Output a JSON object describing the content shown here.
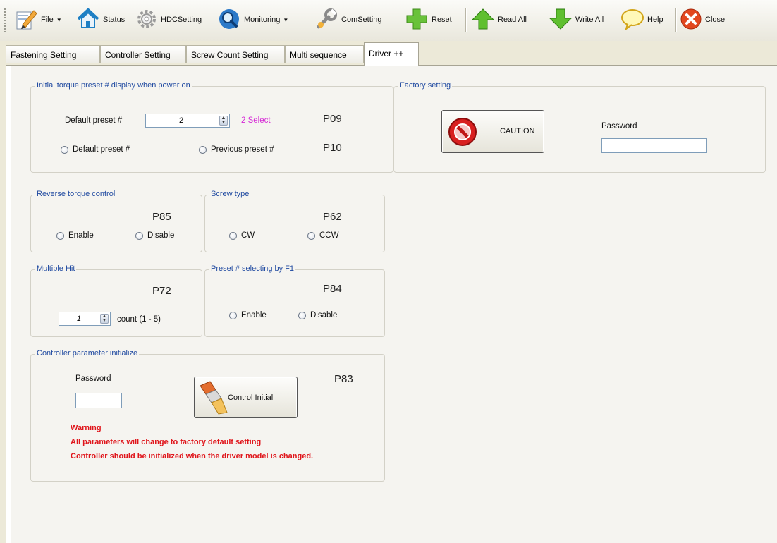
{
  "toolbar": {
    "file": "File",
    "status": "Status",
    "hdc_setting": "HDCSetting",
    "monitoring": "Monitoring",
    "com_setting": "ComSetting",
    "reset": "Reset",
    "read_all": "Read All",
    "write_all": "Write All",
    "help": "Help",
    "close": "Close"
  },
  "tabs": [
    "Fastening Setting",
    "Controller Setting",
    "Screw Count Setting",
    "Multi sequence",
    "Driver ++"
  ],
  "active_tab": "Driver ++",
  "initial_torque": {
    "title": "Initial torque preset # display when power on",
    "default_preset_label": "Default preset #",
    "default_preset_value": "2",
    "select_text": "2 Select",
    "p09": "P09",
    "p10": "P10",
    "radio_default": "Default preset #",
    "radio_previous": "Previous preset #"
  },
  "factory": {
    "title": "Factory setting",
    "caution_label": "CAUTION",
    "password_label": "Password",
    "password_value": ""
  },
  "reverse_torque": {
    "title": "Reverse torque control",
    "code": "P85",
    "enable": "Enable",
    "disable": "Disable"
  },
  "screw_type": {
    "title": "Screw type",
    "code": "P62",
    "cw": "CW",
    "ccw": "CCW"
  },
  "multiple_hit": {
    "title": "Multiple Hit",
    "code": "P72",
    "value": "1",
    "count_label": "count (1 - 5)"
  },
  "preset_f1": {
    "title": "Preset # selecting by F1",
    "code": "P84",
    "enable": "Enable",
    "disable": "Disable"
  },
  "controller_init": {
    "title": "Controller parameter initialize",
    "password_label": "Password",
    "password_value": "",
    "button_label": "Control Initial",
    "code": "P83",
    "warning_title": "Warning",
    "warning_line1": "All parameters will change to factory default setting",
    "warning_line2": "Controller should be initialized when the driver model is changed."
  },
  "colors": {
    "legend_blue": "#1f49a0",
    "select_magenta": "#d62ad6",
    "warning_red": "#e0151b"
  },
  "icons": [
    "document-edit-icon",
    "house-icon",
    "gear-icon",
    "magnifier-icon",
    "wrench-icon",
    "plus-icon",
    "up-arrow-icon",
    "down-arrow-icon",
    "speech-bubble-icon",
    "close-x-icon",
    "no-entry-icon",
    "eraser-icon"
  ]
}
